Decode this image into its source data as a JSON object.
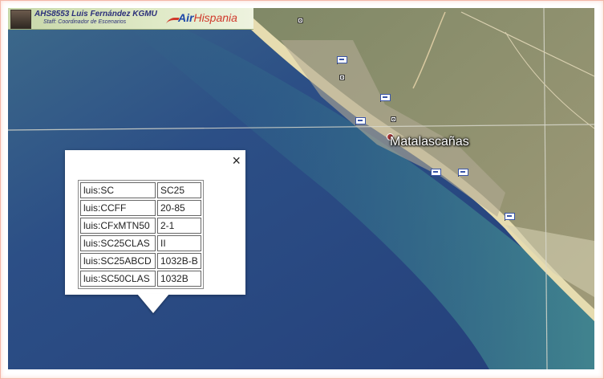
{
  "banner": {
    "name": "AHS8553 Luis Fernández KGMU",
    "role": "Staff: Coordinador de Escenarios",
    "logo_air": "Air",
    "logo_hispania": "Hispania"
  },
  "map": {
    "place_label": "Matalascañas",
    "colors": {
      "sea": "#2d4a86",
      "shallow_sea": "#3f8a8f",
      "beach": "#e9e0b5",
      "land": "#8d8d68",
      "road": "#d8d8cc"
    },
    "icons": [
      "photo-icon",
      "hotel-flag-icon",
      "poi-square-icon",
      "place-dot-icon"
    ]
  },
  "popup": {
    "close_label": "×",
    "rows": [
      {
        "key": "luis:SC",
        "value": "SC25"
      },
      {
        "key": "luis:CCFF",
        "value": "20-85"
      },
      {
        "key": "luis:CFxMTN50",
        "value": "2-1"
      },
      {
        "key": "luis:SC25CLAS",
        "value": "II"
      },
      {
        "key": "luis:SC25ABCD",
        "value": "1032B-B"
      },
      {
        "key": "luis:SC50CLAS",
        "value": "1032B"
      }
    ]
  }
}
